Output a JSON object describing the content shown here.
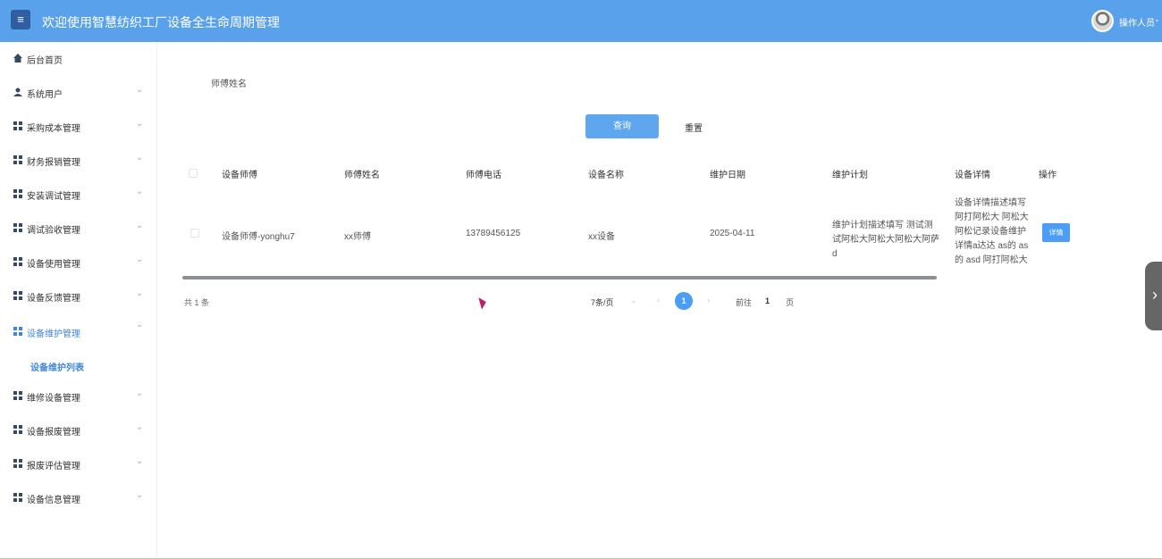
{
  "header": {
    "title": "欢迎使用智慧纺织工厂设备全生命周期管理",
    "menu_icon": "≡",
    "user": "操作人员",
    "user_caret": "⌄"
  },
  "sidebar": {
    "items": [
      {
        "label": "后台首页",
        "icon": "home-icon"
      },
      {
        "label": "系统用户",
        "icon": "person-icon",
        "caret": "⌄"
      },
      {
        "label": "采购成本管理",
        "icon": "grid-icon",
        "caret": "⌄"
      },
      {
        "label": "财务报销管理",
        "icon": "grid-icon",
        "caret": "⌄"
      },
      {
        "label": "安装调试管理",
        "icon": "grid-icon",
        "caret": "⌄"
      },
      {
        "label": "调试验收管理",
        "icon": "grid-icon",
        "caret": "⌄"
      },
      {
        "label": "设备使用管理",
        "icon": "grid-icon",
        "caret": "⌄"
      },
      {
        "label": "设备反馈管理",
        "icon": "grid-icon",
        "caret": "⌄"
      },
      {
        "label": "设备维护管理",
        "icon": "grid-icon",
        "caret": "⌃"
      },
      {
        "label": "维修设备管理",
        "icon": "grid-icon",
        "caret": "⌄"
      },
      {
        "label": "设备报废管理",
        "icon": "grid-icon",
        "caret": "⌄"
      },
      {
        "label": "报废评估管理",
        "icon": "grid-icon",
        "caret": "⌄"
      },
      {
        "label": "设备信息管理",
        "icon": "grid-icon",
        "caret": "⌄"
      }
    ],
    "sub_item": "设备维护列表"
  },
  "filter": {
    "label": "师傅姓名",
    "query_button": "查询",
    "reset_button": "重置"
  },
  "table": {
    "headers": [
      "设备师傅",
      "师傅姓名",
      "师傅电话",
      "设备名称",
      "维护日期",
      "维护计划",
      "设备详情",
      "操作"
    ],
    "rows": [
      {
        "cells": [
          "设备师傅-yonghu7",
          "xx师傅",
          "13789456125",
          "xx设备",
          "2025-04-11",
          "维护计划描述填写 测试测试阿松大阿松大阿松大阿萨d",
          "设备详情描述填写 阿打阿松大 阿松大阿松记录设备维护详情a达达 as的 as的 asd 阿打阿松大"
        ],
        "action": "详情"
      }
    ]
  },
  "pagination": {
    "total": "共 1 条",
    "page_size": "7条/页",
    "size_caret": "⌄",
    "prev": "‹",
    "current": "1",
    "next": "›",
    "goto_label": "前往",
    "goto_value": "1",
    "page_unit": "页"
  },
  "side_handle": "›",
  "colors": {
    "header": "#5aa1ec",
    "primary": "#4b9df5",
    "active_text": "#3f87db"
  }
}
